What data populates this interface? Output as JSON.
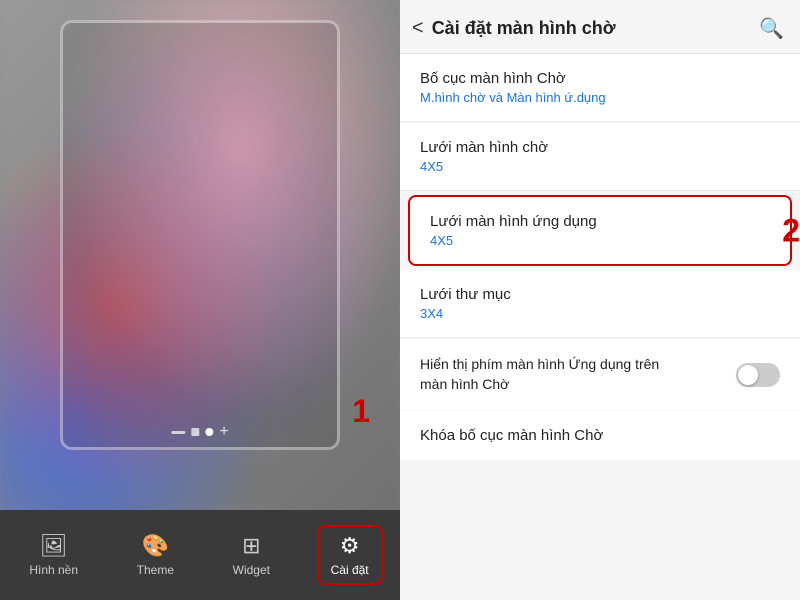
{
  "left": {
    "nav_items": [
      {
        "id": "wallpaper",
        "label": "Hình nền",
        "icon": "🖼"
      },
      {
        "id": "theme",
        "label": "Theme",
        "icon": "🎨"
      },
      {
        "id": "widget",
        "label": "Widget",
        "icon": "⊞"
      },
      {
        "id": "settings",
        "label": "Cài đặt",
        "icon": "⚙",
        "active": true
      }
    ],
    "step_number": "1",
    "dots": [
      "dash",
      "square",
      "circle",
      "plus"
    ]
  },
  "right": {
    "header": {
      "title": "Cài đặt màn hình chờ",
      "back_label": "<",
      "search_label": "🔍"
    },
    "step_number": "2",
    "items": [
      {
        "id": "layout",
        "title": "Bố cục màn hình Chờ",
        "subtitle": "M.hình chờ và Màn hình ứ.dụng",
        "highlighted": false,
        "has_toggle": false
      },
      {
        "id": "home-grid",
        "title": "Lưới màn hình chờ",
        "subtitle": "4X5",
        "highlighted": false,
        "has_toggle": false
      },
      {
        "id": "app-grid",
        "title": "Lưới màn hình ứng dụng",
        "subtitle": "4X5",
        "highlighted": true,
        "has_toggle": false
      },
      {
        "id": "folder-grid",
        "title": "Lưới thư mục",
        "subtitle": "3X4",
        "highlighted": false,
        "has_toggle": false
      },
      {
        "id": "show-apps",
        "title": "Hiển thị phím màn hình Ứng dụng trên màn hình Chờ",
        "subtitle": "",
        "highlighted": false,
        "has_toggle": true
      },
      {
        "id": "lock-layout",
        "title": "Khóa bố cục màn hình Chờ",
        "subtitle": "",
        "highlighted": false,
        "has_toggle": false
      }
    ]
  }
}
